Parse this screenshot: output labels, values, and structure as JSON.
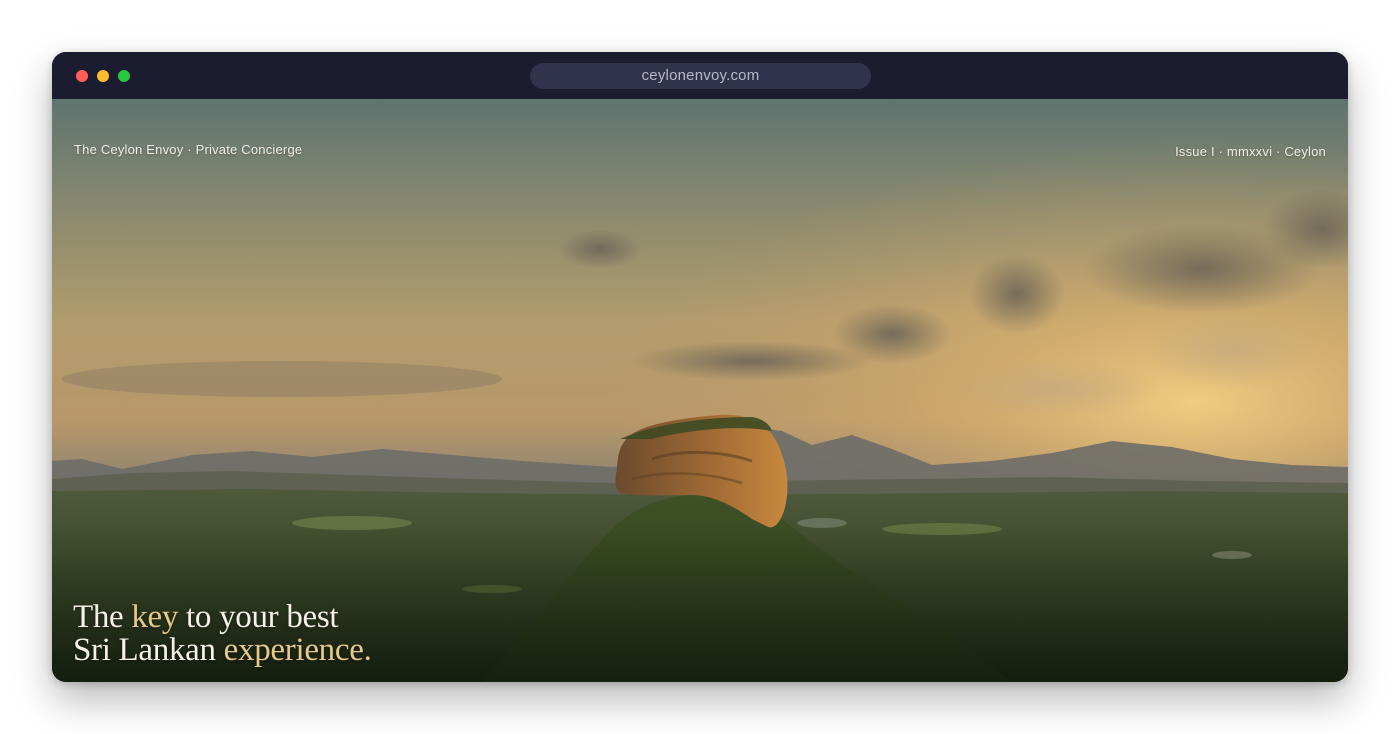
{
  "window": {
    "url": "ceylonenvoy.com",
    "controls": {
      "close_color": "#ff5f57",
      "minimize_color": "#febc2e",
      "maximize_color": "#28c840"
    }
  },
  "hero": {
    "brand": "The Ceylon Envoy · Private Concierge",
    "issue": "Issue I · mmxxvi · Ceylon",
    "headline": {
      "line1_a": "The ",
      "line1_accent": "key",
      "line1_b": " to your best",
      "line2_a": "Sri Lankan ",
      "line2_accent": "experience."
    },
    "accent_color": "#e6c88a"
  }
}
